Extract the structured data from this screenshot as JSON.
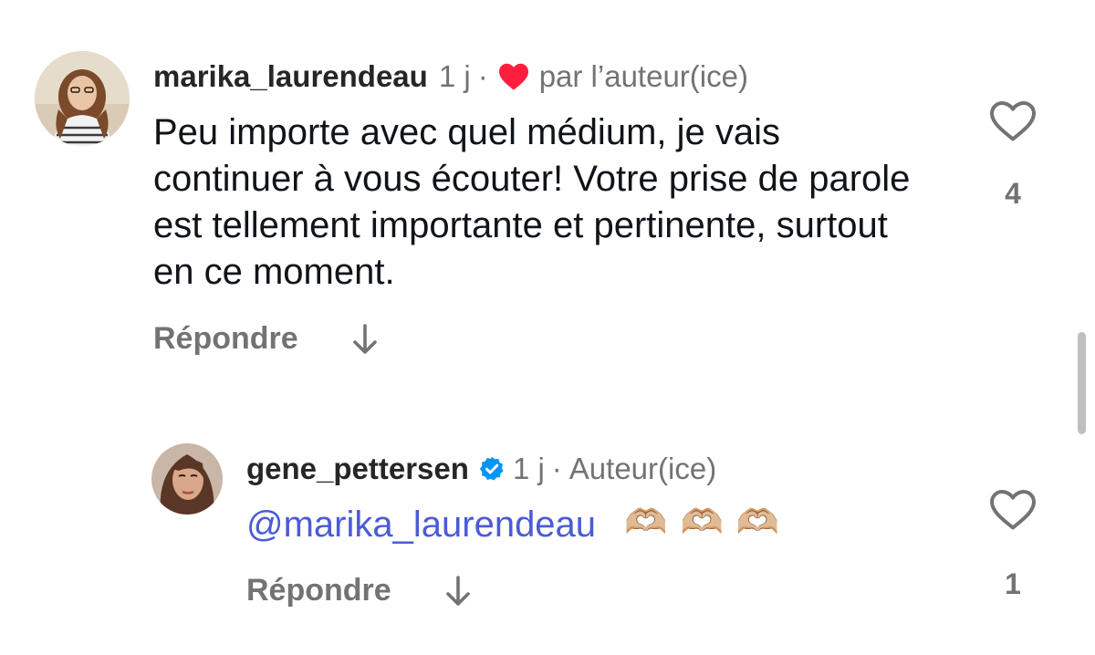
{
  "comments": [
    {
      "username": "marika_laurendeau",
      "time": "1 j",
      "separator": "·",
      "liked_by_author_label": "par l’auteur(ice)",
      "text": "Peu importe avec quel médium, je vais continuer à vous écouter! Votre prise de parole est tellement importante et pertinente, surtout en ce moment.",
      "reply_label": "Répondre",
      "like_count": "4",
      "icons": {
        "avatar": "avatar-photo",
        "liked_heart": "red-heart-icon",
        "like": "heart-outline-icon",
        "view_replies": "arrow-down-icon"
      }
    },
    {
      "username": "gene_pettersen",
      "time": "1 j",
      "separator": "·",
      "author_label": "Auteur(ice)",
      "mention": "@marika_laurendeau",
      "emojis": [
        "🫶🏼",
        "🫶🏼",
        "🫶🏼"
      ],
      "reply_label": "Répondre",
      "like_count": "1",
      "icons": {
        "avatar": "avatar-photo",
        "verified": "verified-badge-icon",
        "like": "heart-outline-icon",
        "view_replies": "arrow-down-icon"
      }
    }
  ],
  "colors": {
    "text": "#0f1419",
    "secondary": "#737373",
    "mention": "#4a5bd8",
    "liked_heart": "#ff1f3d",
    "verified": "#0095f6"
  }
}
